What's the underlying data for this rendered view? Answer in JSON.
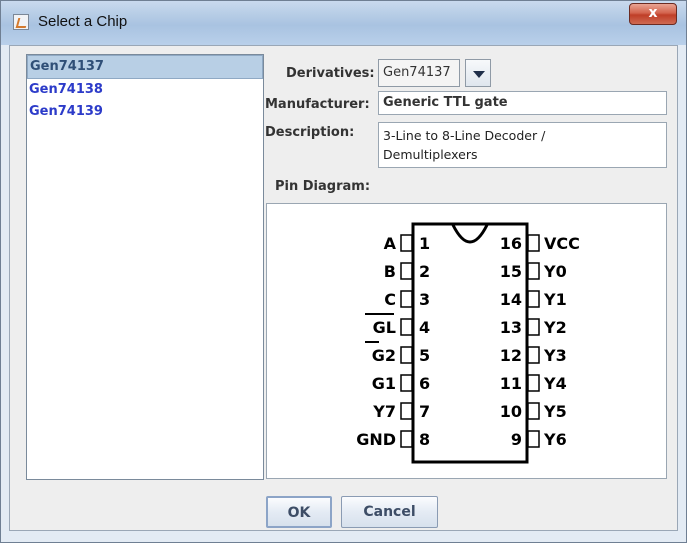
{
  "window": {
    "title": "Select a Chip",
    "close_label": "x"
  },
  "chips": [
    {
      "label": "Gen74137",
      "selected": true
    },
    {
      "label": "Gen74138",
      "selected": false
    },
    {
      "label": "Gen74139",
      "selected": false
    }
  ],
  "details": {
    "derivatives_label": "Derivatives:",
    "derivatives_value": "Gen74137",
    "manufacturer_label": "Manufacturer:",
    "manufacturer_value": "Generic TTL gate",
    "description_label": "Description:",
    "description_line1": "3-Line to 8-Line Decoder /",
    "description_line2": "Demultiplexers",
    "pin_diagram_label": "Pin Diagram:"
  },
  "pins_left": [
    {
      "name": "A",
      "num": "1",
      "bar": false
    },
    {
      "name": "B",
      "num": "2",
      "bar": false
    },
    {
      "name": "C",
      "num": "3",
      "bar": false
    },
    {
      "name": "GL",
      "num": "4",
      "bar": true
    },
    {
      "name": "G2",
      "num": "5",
      "bar": true,
      "bar_first_only": true
    },
    {
      "name": "G1",
      "num": "6",
      "bar": false
    },
    {
      "name": "Y7",
      "num": "7",
      "bar": false
    },
    {
      "name": "GND",
      "num": "8",
      "bar": false
    }
  ],
  "pins_right": [
    {
      "name": "VCC",
      "num": "16"
    },
    {
      "name": "Y0",
      "num": "15"
    },
    {
      "name": "Y1",
      "num": "14"
    },
    {
      "name": "Y2",
      "num": "13"
    },
    {
      "name": "Y3",
      "num": "12"
    },
    {
      "name": "Y4",
      "num": "11"
    },
    {
      "name": "Y5",
      "num": "10"
    },
    {
      "name": "Y6",
      "num": "9"
    }
  ],
  "buttons": {
    "ok": "OK",
    "cancel": "Cancel"
  },
  "icons": {
    "app": "java-cup-icon",
    "dropdown": "chevron-down-icon",
    "close": "close-icon"
  }
}
